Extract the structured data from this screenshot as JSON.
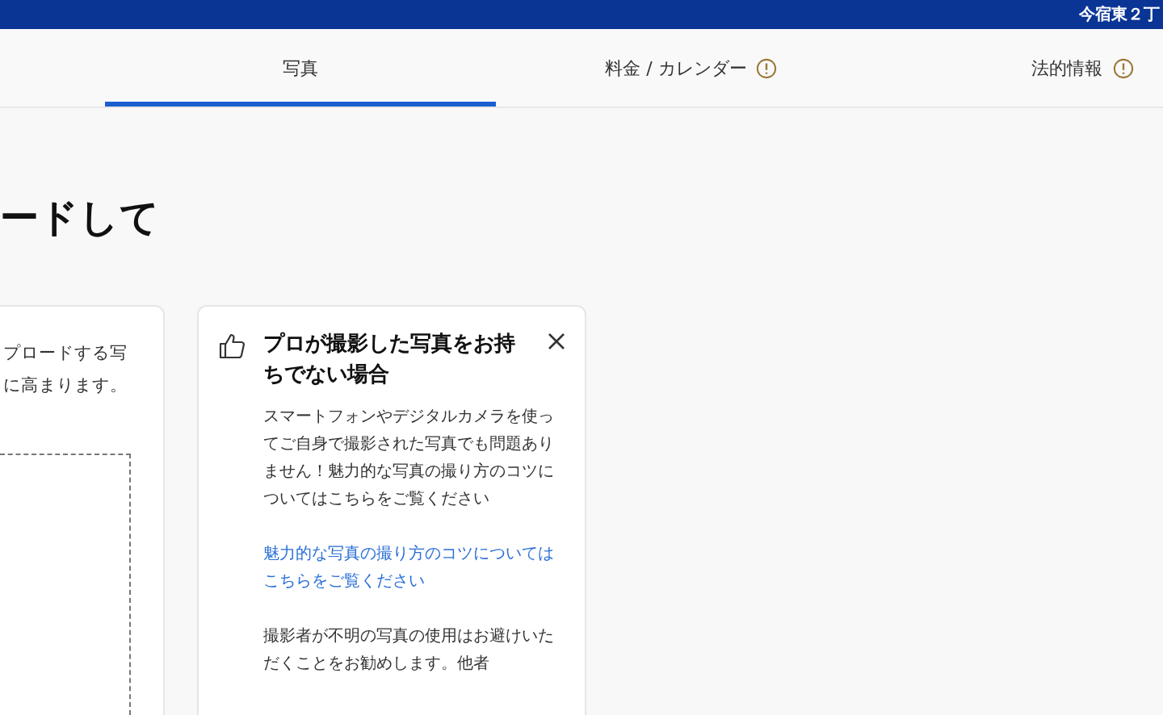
{
  "top_bar": {
    "text": "今宿東２丁"
  },
  "tabs": [
    {
      "label": "写真",
      "selected": true,
      "warning": false
    },
    {
      "label": "料金 / カレンダー",
      "selected": false,
      "warning": true
    },
    {
      "label": "法的情報",
      "selected": false,
      "warning": true
    }
  ],
  "heading": "ードして",
  "upload_card": {
    "lines": [
      "プロードする写",
      "に高まります。"
    ]
  },
  "tip_card": {
    "title": "プロが撮影した写真をお持ちでない場合",
    "body": "スマートフォンやデジタルカメラを使ってご自身で撮影された写真でも問題ありません！魅力的な写真の撮り方のコツについてはこちらをご覧ください",
    "link": "魅力的な写真の撮り方のコツについてはこちらをご覧ください",
    "note": "撮影者が不明の写真の使用はお避けいただくことをお勧めします。他者"
  }
}
